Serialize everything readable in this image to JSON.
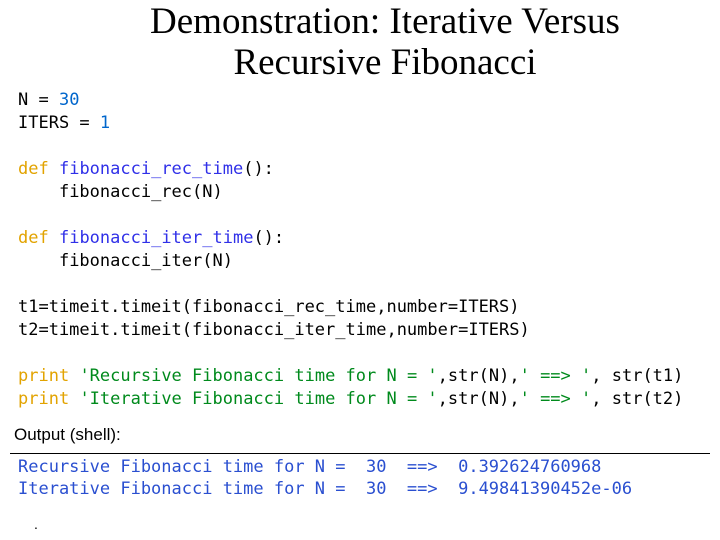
{
  "title": "Demonstration: Iterative Versus Recursive Fibonacci",
  "code": {
    "l1a": "N = ",
    "l1b": "30",
    "l2a": "ITERS = ",
    "l2b": "1",
    "def": "def",
    "fn_rec_time": "fibonacci_rec_time",
    "fn_iter_time": "fibonacci_iter_time",
    "call_rec": "fibonacci_rec(N)",
    "call_iter": "fibonacci_iter(N)",
    "t1": "t1=timeit.timeit(fibonacci_rec_time,number=ITERS)",
    "t2": "t2=timeit.timeit(fibonacci_iter_time,number=ITERS)",
    "print": "print",
    "p1s1": "'Recursive Fibonacci time for N = '",
    "p1s2": "' ==> '",
    "p1v1": "str(N)",
    "p1v2": " str(t1)",
    "p2s1": "'Iterative Fibonacci time for N = '",
    "p2s2": "' ==> '",
    "p2v1": "str(N)",
    "p2v2": " str(t2)",
    "paren_open": "():",
    "comma": ","
  },
  "output_label": "Output (shell):",
  "shell": {
    "l1": "Recursive Fibonacci time for N =  30  ==>  0.392624760968",
    "l2": "Iterative Fibonacci time for N =  30  ==>  9.49841390452e-06"
  },
  "footer": "."
}
